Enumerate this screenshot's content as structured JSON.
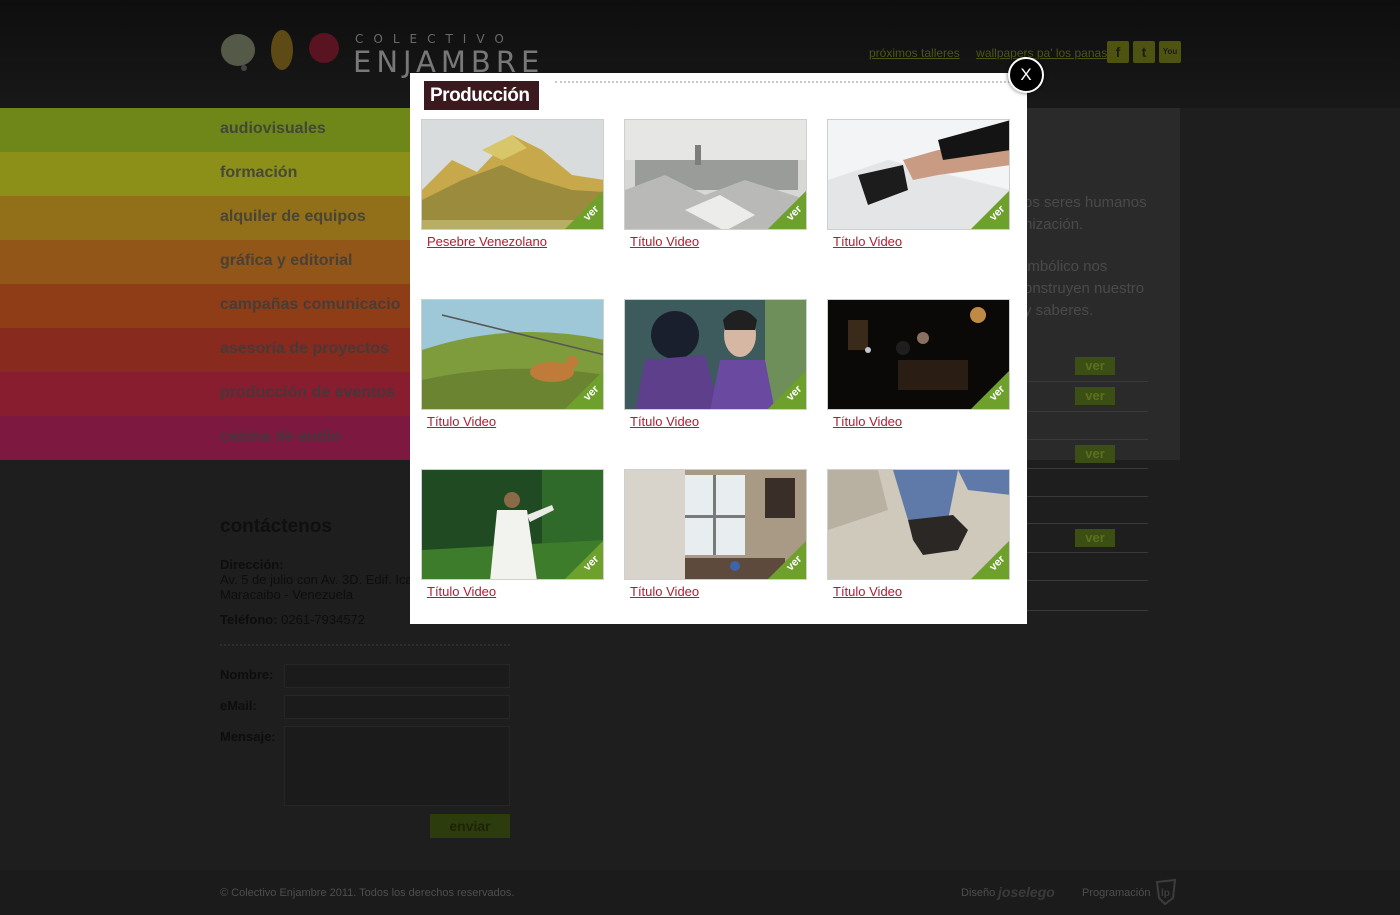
{
  "header": {
    "logo_line1": "COLECTIVO",
    "logo_line2": "ENJAMBRE",
    "links": [
      "próximos talleres",
      "wallpapers pa' los panas"
    ],
    "social": [
      {
        "icon": "facebook-icon",
        "glyph": "f"
      },
      {
        "icon": "twitter-icon",
        "glyph": "t"
      },
      {
        "icon": "youtube-icon",
        "glyph": "You"
      }
    ]
  },
  "menu": {
    "items": [
      {
        "label": "audiovisuales",
        "color": "#6f8718"
      },
      {
        "label": "formación",
        "color": "#8c8f18"
      },
      {
        "label": "alquiler de equipos",
        "color": "#927019"
      },
      {
        "label": "gráfica y editorial",
        "color": "#925618"
      },
      {
        "label": "campañas comunicacio",
        "color": "#8f3d17"
      },
      {
        "label": "asesoría de proyectos",
        "color": "#892a1f"
      },
      {
        "label": "producción de eventos",
        "color": "#871d2e"
      },
      {
        "label": "cabina de audio",
        "color": "#7d1840"
      }
    ]
  },
  "right_panel": {
    "text_lines": [
      "os seres humanos",
      "nización.",
      "imbólico nos",
      "onstruyen nuestro",
      "y saberes."
    ],
    "ver_label": "ver"
  },
  "contact": {
    "title": "contáctenos",
    "address_label": "Dirección:",
    "address_line1": "Av. 5 de julio con Av. 3D. Edif. Ica",
    "address_line2": "Maracaibo - Venezuela",
    "phone_label": "Teléfono:",
    "phone": "0261-7934572",
    "name_label": "Nombre:",
    "email_label": "eMail:",
    "message_label": "Mensaje:",
    "send_label": "enviar"
  },
  "footer": {
    "copyright": "© Colectivo Enjambre 2011. Todos los derechos reservados.",
    "design_label": "Diseño",
    "design_logo": "joselego",
    "programming_label": "Programación"
  },
  "modal": {
    "title": "Producción",
    "close_label": "X",
    "ver_label": "ver",
    "videos": [
      {
        "title": "Pesebre Venezolano",
        "scene": "mountain-model"
      },
      {
        "title": "Título Video",
        "scene": "snowy-city"
      },
      {
        "title": "Título Video",
        "scene": "hand-box"
      },
      {
        "title": "Título Video",
        "scene": "green-field-animation"
      },
      {
        "title": "Título Video",
        "scene": "two-men-purple-sweater"
      },
      {
        "title": "Título Video",
        "scene": "dark-restaurant"
      },
      {
        "title": "Título Video",
        "scene": "jesus-figure-forest"
      },
      {
        "title": "Título Video",
        "scene": "window-curtains-room"
      },
      {
        "title": "Título Video",
        "scene": "stepping-shoe"
      }
    ]
  }
}
